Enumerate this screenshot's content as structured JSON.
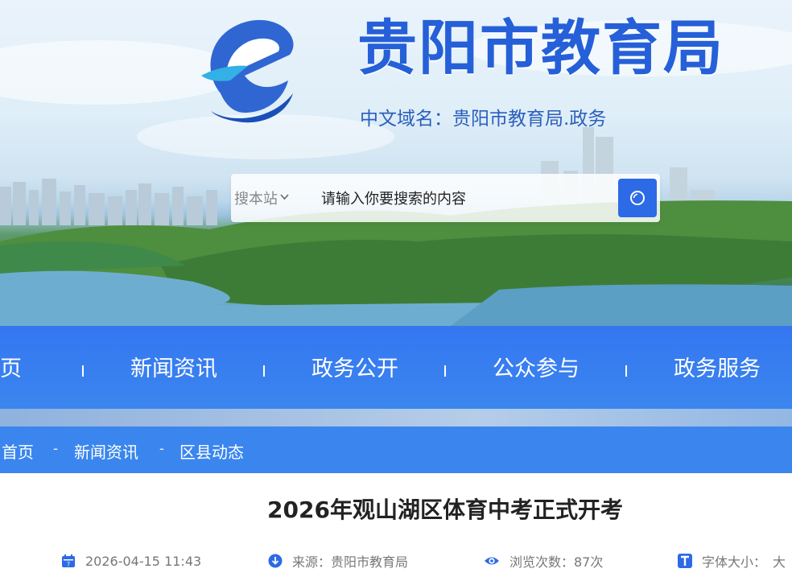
{
  "header": {
    "site_title": "贵阳市教育局",
    "domain_label": "中文域名：",
    "domain_value": "贵阳市教育局.政务",
    "logo_icon": "e-logo-icon"
  },
  "search": {
    "scope_label": "搜本站",
    "placeholder": "请输入你要搜索的内容",
    "button_icon": "search-icon"
  },
  "nav": {
    "items": [
      {
        "label": "页"
      },
      {
        "label": "新闻资讯"
      },
      {
        "label": "政务公开"
      },
      {
        "label": "公众参与"
      },
      {
        "label": "政务服务"
      }
    ]
  },
  "breadcrumb": {
    "items": [
      "首页",
      "新闻资讯",
      "区县动态"
    ],
    "separator": "-"
  },
  "article": {
    "title": "2026年观山湖区体育中考正式开考",
    "date": "2026-04-15 11:43",
    "source": "来源：贵阳市教育局",
    "views": "浏览次数：87次",
    "font_size_label": "字体大小：",
    "font_size_option": "大"
  },
  "colors": {
    "primary": "#2d6ae6",
    "nav_bg": "#3a86ee",
    "title_blue": "#2560d8"
  }
}
